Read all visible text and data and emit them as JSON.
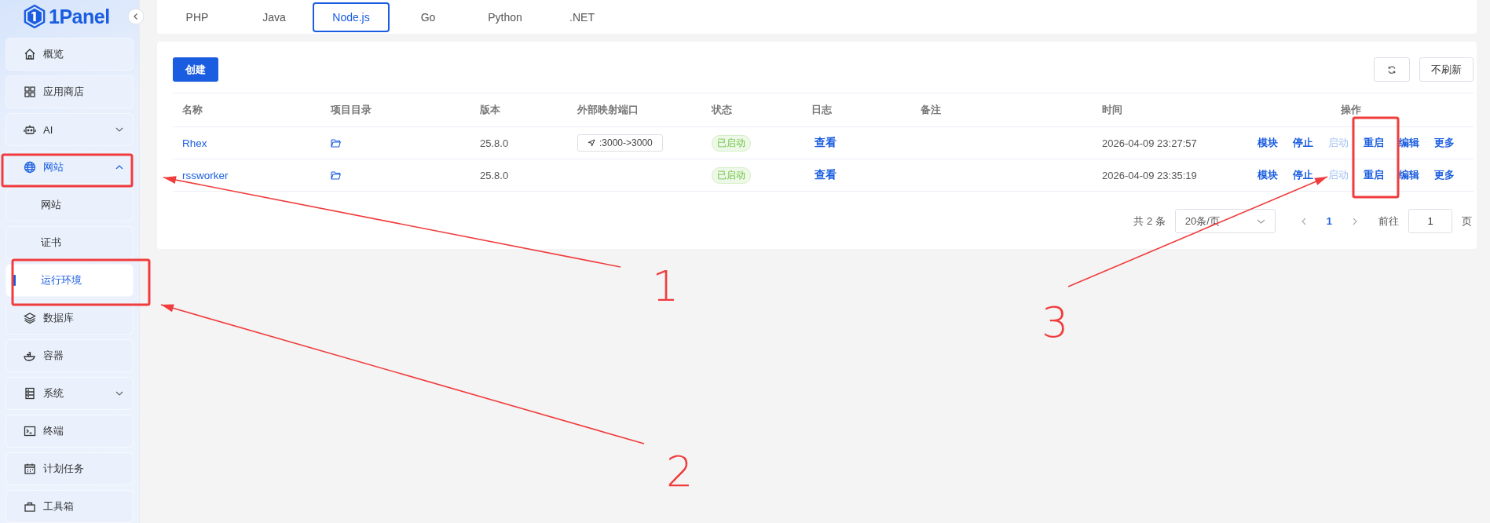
{
  "logo": {
    "text": "1Panel"
  },
  "sidebar": {
    "items": [
      {
        "label": "概览",
        "selected": false
      },
      {
        "label": "应用商店",
        "selected": false
      },
      {
        "label": "AI",
        "selected": false,
        "expanded": false
      },
      {
        "label": "网站",
        "selected": false,
        "expanded": true,
        "children": [
          {
            "label": "网站",
            "selected": false
          },
          {
            "label": "证书",
            "selected": false
          },
          {
            "label": "运行环境",
            "selected": true
          }
        ]
      },
      {
        "label": "数据库",
        "selected": false
      },
      {
        "label": "容器",
        "selected": false
      },
      {
        "label": "系统",
        "selected": false,
        "expanded": false
      },
      {
        "label": "终端",
        "selected": false
      },
      {
        "label": "计划任务",
        "selected": false
      },
      {
        "label": "工具箱",
        "selected": false
      }
    ]
  },
  "tabs": [
    {
      "label": "PHP",
      "selected": false
    },
    {
      "label": "Java",
      "selected": false
    },
    {
      "label": "Node.js",
      "selected": true
    },
    {
      "label": "Go",
      "selected": false
    },
    {
      "label": "Python",
      "selected": false
    },
    {
      "label": ".NET",
      "selected": false
    }
  ],
  "toolbar": {
    "create": "创建",
    "no_refresh": "不刷新"
  },
  "table": {
    "columns": [
      "名称",
      "项目目录",
      "版本",
      "外部映射端口",
      "状态",
      "日志",
      "备注",
      "时间",
      "操作"
    ],
    "rows": [
      {
        "name": "Rhex",
        "version": "25.8.0",
        "port": ":3000->3000",
        "status": "已启动",
        "log": "查看",
        "time": "2026-04-09 23:27:57",
        "actions": [
          {
            "label": "模块",
            "disabled": false
          },
          {
            "label": "停止",
            "disabled": false
          },
          {
            "label": "启动",
            "disabled": true
          },
          {
            "label": "重启",
            "disabled": false
          },
          {
            "label": "编辑",
            "disabled": false
          },
          {
            "label": "更多",
            "disabled": false
          }
        ]
      },
      {
        "name": "rssworker",
        "version": "25.8.0",
        "status": "已启动",
        "log": "查看",
        "time": "2026-04-09 23:35:19",
        "actions": [
          {
            "label": "模块",
            "disabled": false
          },
          {
            "label": "停止",
            "disabled": false
          },
          {
            "label": "启动",
            "disabled": true
          },
          {
            "label": "重启",
            "disabled": false
          },
          {
            "label": "编辑",
            "disabled": false
          },
          {
            "label": "更多",
            "disabled": false
          }
        ]
      }
    ]
  },
  "pagination": {
    "total": "共 2 条",
    "page_size": "20条/页",
    "current": "1",
    "goto": "前往",
    "goto_value": "1",
    "page_unit": "页"
  },
  "annotations": {
    "labels": [
      "1",
      "2",
      "3"
    ]
  }
}
